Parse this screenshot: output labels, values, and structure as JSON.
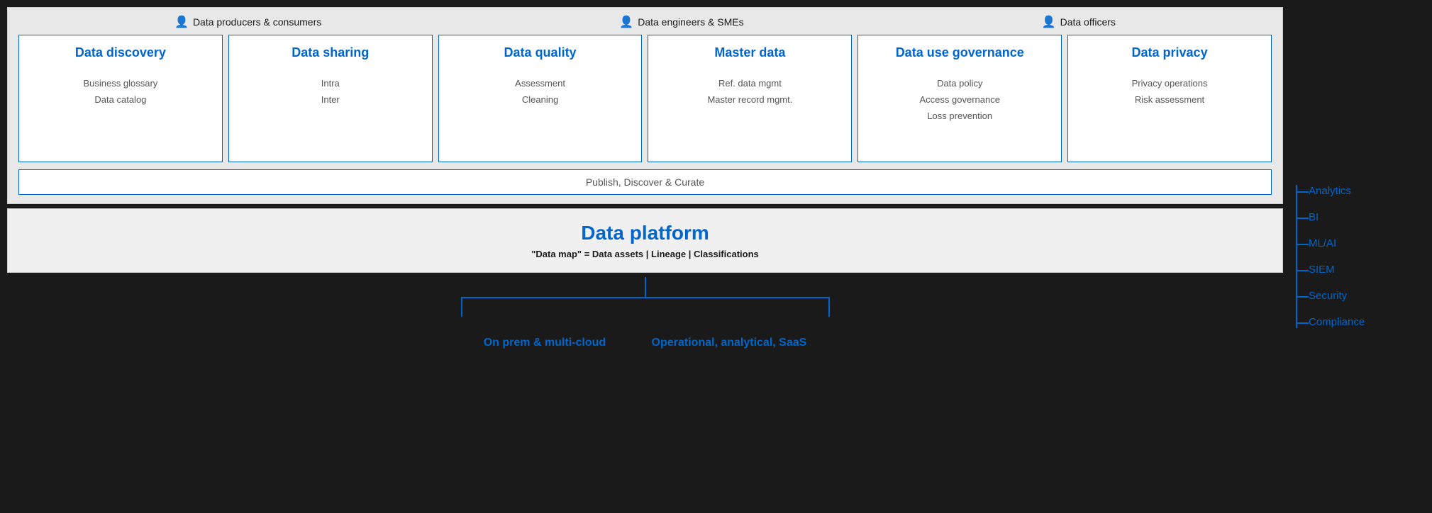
{
  "personas": [
    {
      "label": "Data producers & consumers"
    },
    {
      "label": "Data engineers & SMEs"
    },
    {
      "label": "Data officers"
    }
  ],
  "gov_boxes": [
    {
      "title": "Data discovery",
      "items": [
        "Business glossary",
        "Data catalog"
      ]
    },
    {
      "title": "Data sharing",
      "items": [
        "Intra",
        "Inter"
      ]
    },
    {
      "title": "Data quality",
      "items": [
        "Assessment",
        "Cleaning"
      ]
    },
    {
      "title": "Master data",
      "items": [
        "Ref. data mgmt",
        "Master record mgmt."
      ]
    },
    {
      "title": "Data use governance",
      "items": [
        "Data policy",
        "Access governance",
        "Loss prevention"
      ]
    },
    {
      "title": "Data privacy",
      "items": [
        "Privacy operations",
        "Risk assessment"
      ]
    }
  ],
  "publish_bar": "Publish, Discover & Curate",
  "platform": {
    "title": "Data platform",
    "subtitle": "\"Data map\" = Data assets | Lineage | Classifications"
  },
  "sources": [
    {
      "label": "On prem & multi-cloud"
    },
    {
      "label": "Operational, analytical, SaaS"
    }
  ],
  "sidebar_items": [
    {
      "label": "Analytics"
    },
    {
      "label": "BI"
    },
    {
      "label": "ML/AI"
    },
    {
      "label": "SIEM"
    },
    {
      "label": "Security"
    },
    {
      "label": "Compliance"
    }
  ]
}
